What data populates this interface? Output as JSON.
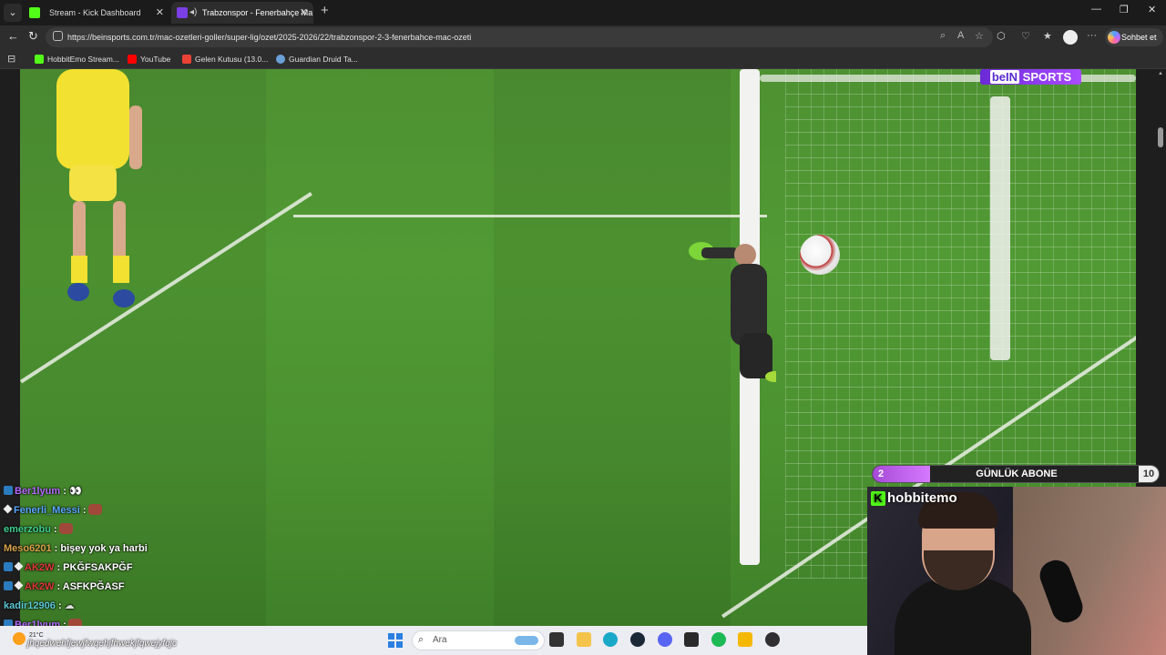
{
  "browser": {
    "tabs": [
      {
        "title": "Stream - Kick Dashboard",
        "favicon_color": "#53fc18"
      },
      {
        "title": "Trabzonspor - Fenerbahçe Ma",
        "favicon_color": "#7b3fe4"
      }
    ],
    "new_tab_label": "+",
    "url": "https://beinsports.com.tr/mac-ozetleri-goller/super-lig/ozet/2025-2026/22/trabzonspor-2-3-fenerbahce-mac-ozeti",
    "copilot_label": "Sohbet et",
    "bookmarks": [
      {
        "label": "HobbitEmo Stream...",
        "color": "#53fc18"
      },
      {
        "label": "YouTube",
        "color": "#ff0000"
      },
      {
        "label": "Gelen Kutusu (13.0...",
        "color": "#ea4335"
      },
      {
        "label": "Guardian Druid Ta...",
        "color": "#6aa0d8"
      }
    ]
  },
  "video": {
    "brand_part1": "beIN",
    "brand_part2": "SPORTS"
  },
  "chat": {
    "messages": [
      {
        "user": "Ber1lyum",
        "text": ":",
        "user_color": "#b36bff"
      },
      {
        "user": "Fenerli_Messi",
        "text": ":",
        "user_color": "#5aa9ff"
      },
      {
        "user": "emerzobu",
        "text": ":",
        "user_color": "#3ecf8e"
      },
      {
        "user": "Meso6201",
        "text": ": bişey yok ya harbi",
        "user_color": "#d9a24a"
      },
      {
        "user": "AK2W",
        "text": ": PKĞFSAKPĞF",
        "user_color": "#e03a3a"
      },
      {
        "user": "AK2W",
        "text": ": ASFKPĞASF",
        "user_color": "#e03a3a"
      },
      {
        "user": "kadir12906",
        "text": ":",
        "user_color": "#5cc8d6"
      },
      {
        "user": "Ber1lyum",
        "text": ":",
        "user_color": "#b36bff"
      }
    ]
  },
  "goal_bar": {
    "current": "2",
    "label": "GÜNLÜK ABONE",
    "target": "10",
    "progress": 0.2
  },
  "webcam": {
    "channel": "hobbitemo"
  },
  "taskbar": {
    "temperature": "21°C",
    "ticker": "jhqedwehfjewjfwqehjfhwekjfqwejyfqjc",
    "search_placeholder": "Ara",
    "icons": [
      {
        "name": "task-view-icon",
        "color": "#333333"
      },
      {
        "name": "file-explorer-icon",
        "color": "#f4c34a"
      },
      {
        "name": "edge-icon",
        "color": "#1aa8c8"
      },
      {
        "name": "steam-icon",
        "color": "#1b2838"
      },
      {
        "name": "discord-icon",
        "color": "#5865f2"
      },
      {
        "name": "terminal-icon",
        "color": "#2b2b2b"
      },
      {
        "name": "spotify-icon",
        "color": "#1db954"
      },
      {
        "name": "rockstar-icon",
        "color": "#f5b800"
      },
      {
        "name": "obs-icon",
        "color": "#302e31"
      }
    ]
  }
}
